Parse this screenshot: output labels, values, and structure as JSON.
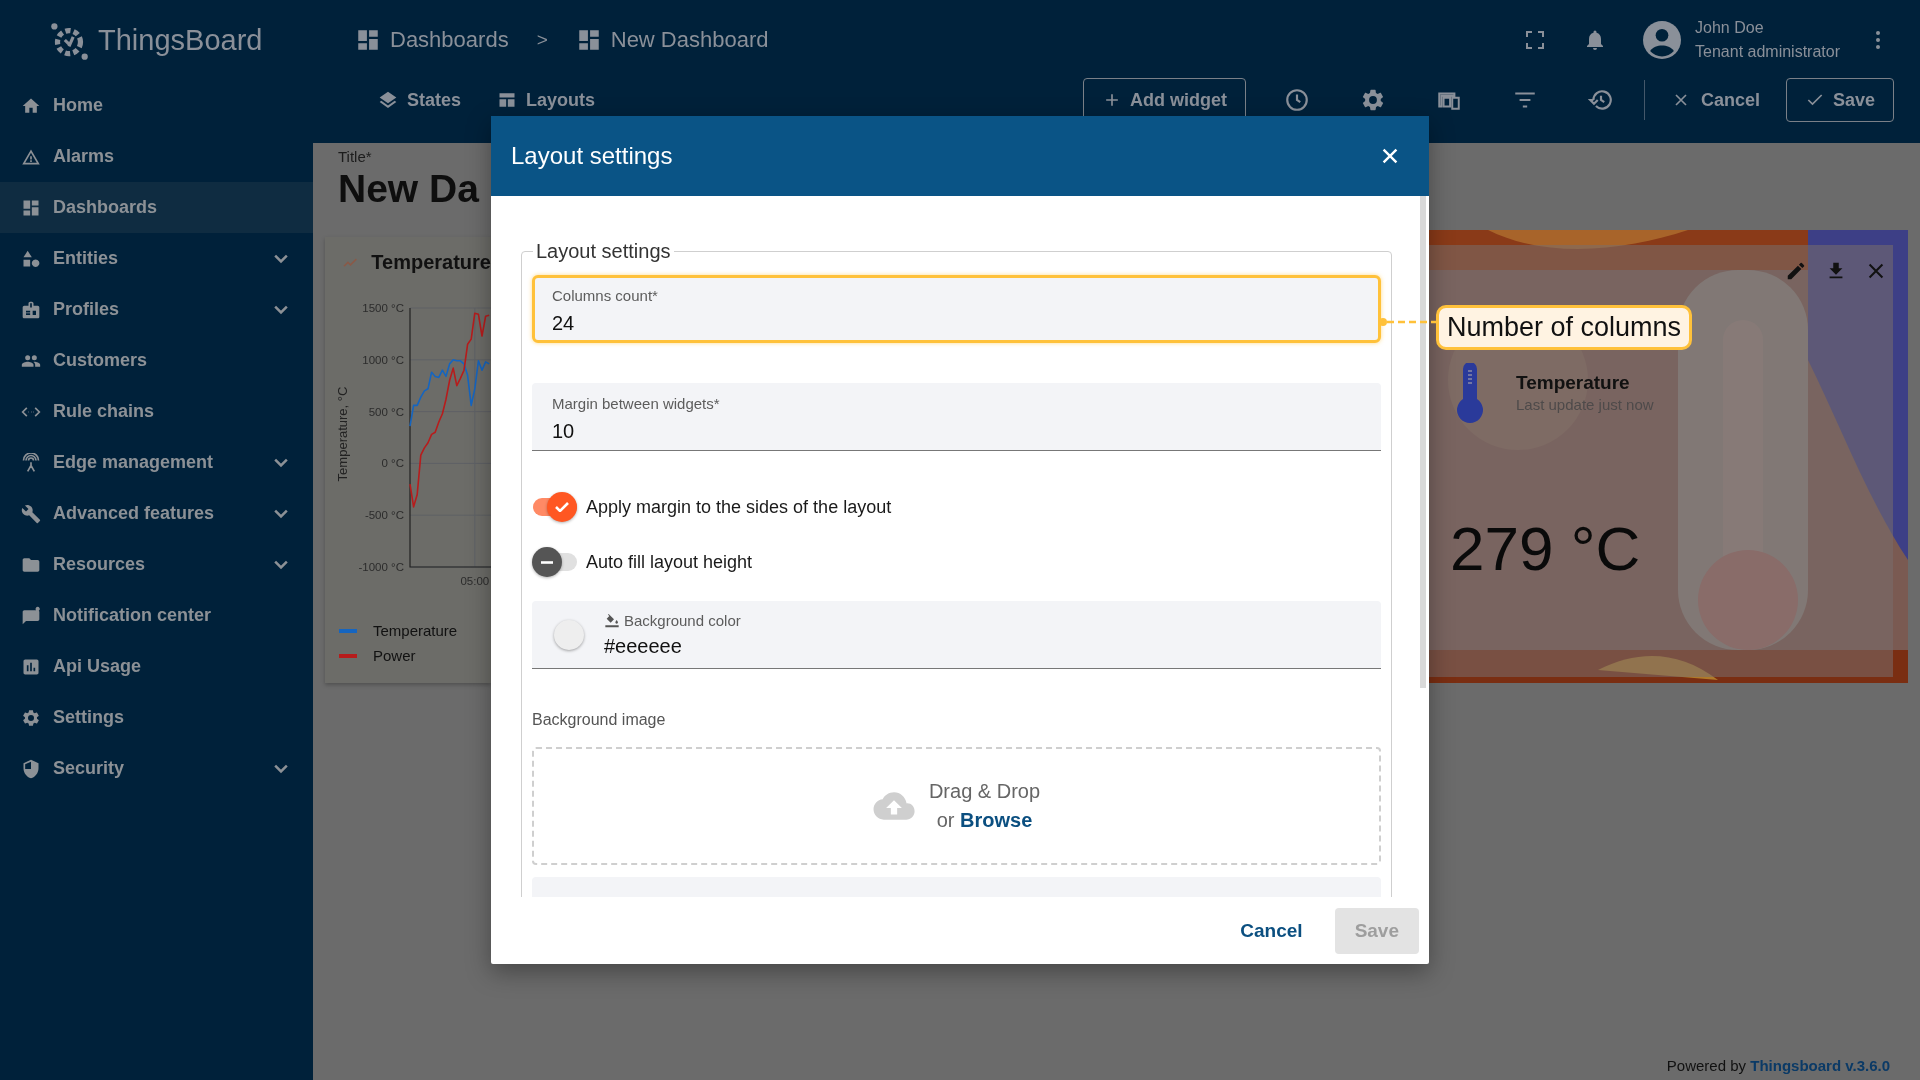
{
  "app": {
    "logo_text": "ThingsBoard"
  },
  "header": {
    "breadcrumbs": [
      {
        "label": "Dashboards"
      },
      {
        "label": "New Dashboard"
      }
    ],
    "separator": ">",
    "user": {
      "name": "John Doe",
      "role": "Tenant administrator"
    }
  },
  "sidebar": {
    "items": [
      {
        "label": "Home",
        "selected": false,
        "expandable": false
      },
      {
        "label": "Alarms",
        "selected": false,
        "expandable": false
      },
      {
        "label": "Dashboards",
        "selected": true,
        "expandable": false
      },
      {
        "label": "Entities",
        "selected": false,
        "expandable": true
      },
      {
        "label": "Profiles",
        "selected": false,
        "expandable": true
      },
      {
        "label": "Customers",
        "selected": false,
        "expandable": false
      },
      {
        "label": "Rule chains",
        "selected": false,
        "expandable": false
      },
      {
        "label": "Edge management",
        "selected": false,
        "expandable": true
      },
      {
        "label": "Advanced features",
        "selected": false,
        "expandable": true
      },
      {
        "label": "Resources",
        "selected": false,
        "expandable": true
      },
      {
        "label": "Notification center",
        "selected": false,
        "expandable": false
      },
      {
        "label": "Api Usage",
        "selected": false,
        "expandable": false
      },
      {
        "label": "Settings",
        "selected": false,
        "expandable": false
      },
      {
        "label": "Security",
        "selected": false,
        "expandable": true
      }
    ]
  },
  "toolbar": {
    "tabs": [
      {
        "label": "States"
      },
      {
        "label": "Layouts"
      }
    ],
    "add_widget": "Add widget",
    "cancel": "Cancel",
    "save": "Save"
  },
  "dashboard": {
    "title_label": "Title*",
    "title": "New Da",
    "chart_widget": {
      "title": "Temperature",
      "x_tick_label": "05:00",
      "chart_data": {
        "type": "line",
        "ylabel": "Temperature, °C",
        "grid": true,
        "ylim": [
          -1000,
          1500
        ],
        "yticks": [
          {
            "value": 1500,
            "label": "1500 °C"
          },
          {
            "value": 1000,
            "label": "1000 °C"
          },
          {
            "value": 500,
            "label": "500 °C"
          },
          {
            "value": 0,
            "label": "0 °C"
          },
          {
            "value": -500,
            "label": "-500 °C"
          },
          {
            "value": -1000,
            "label": "-1000 °C"
          }
        ],
        "series": [
          {
            "name": "Temperature",
            "color": "#1565c0",
            "values": [
              360,
              560,
              560,
              640,
              700,
              720,
              880,
              840,
              830,
              900,
              840,
              960,
              1000,
              990,
              990,
              960,
              850,
              560,
              720,
              990,
              900,
              980,
              960
            ]
          },
          {
            "name": "Power",
            "color": "#b71c1c",
            "values": [
              -200,
              -420,
              -300,
              80,
              150,
              200,
              280,
              300,
              400,
              480,
              620,
              800,
              920,
              750,
              820,
              900,
              1150,
              1200,
              1450,
              1440,
              1230,
              1420,
              1430
            ]
          }
        ]
      }
    },
    "value_widget": {
      "title": "Temperature",
      "subtitle": "Last update just now",
      "value": "279 °C"
    }
  },
  "dialog": {
    "title": "Layout settings",
    "section_title": "Layout settings",
    "fields": [
      {
        "label": "Columns count*",
        "value": "24",
        "highlighted": true
      },
      {
        "label": "Margin between widgets*",
        "value": "10",
        "highlighted": false
      }
    ],
    "toggles": [
      {
        "label": "Apply margin to the sides of the layout",
        "on": true
      },
      {
        "label": "Auto fill layout height",
        "on": false
      }
    ],
    "color_field": {
      "label": "Background color",
      "value": "#eeeeee",
      "color": "#eeeeee"
    },
    "image_label": "Background image",
    "drop_text": "Drag & Drop",
    "or_text": "or",
    "browse": "Browse",
    "cancel": "Cancel",
    "save": {
      "label": "Save",
      "disabled": true
    }
  },
  "annotation": {
    "text": "Number of columns"
  },
  "footer": {
    "powered_by": "Powered by",
    "link": "Thingsboard v.3.6.0"
  }
}
